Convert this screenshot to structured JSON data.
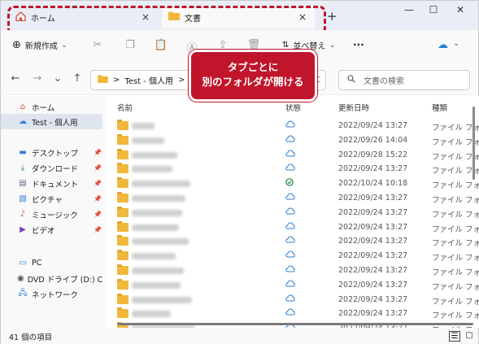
{
  "tabs": [
    {
      "label": "ホーム",
      "icon": "home-icon",
      "close": "×"
    },
    {
      "label": "文書",
      "icon": "folder-icon",
      "close": "×"
    }
  ],
  "new_tab": "+",
  "window_controls": {
    "minimize": "—",
    "maximize": "☐",
    "close": "✕"
  },
  "toolbar": {
    "new_label": "新規作成",
    "new_chevron": "⌄",
    "sort_label": "並べ替え",
    "sort_chevron": "⌄",
    "more": "···"
  },
  "address": {
    "back": "←",
    "forward": "→",
    "recent": "⌄",
    "up": "↑",
    "sep1": ">",
    "part1": "Test - 個人用",
    "sep2": ">",
    "part2": "文",
    "refresh": "C"
  },
  "search": {
    "placeholder": "文書の検索"
  },
  "callout": {
    "line1": "タブごとに",
    "line2": "別のフォルダが開ける"
  },
  "nav": {
    "home": "ホーム",
    "onedrive": "Test - 個人用",
    "desktop": "デスクトップ",
    "downloads": "ダウンロード",
    "documents": "ドキュメント",
    "pictures": "ピクチャ",
    "music": "ミュージック",
    "videos": "ビデオ",
    "pc": "PC",
    "dvd": "DVD ドライブ (D:) CCCC",
    "network": "ネットワーク"
  },
  "columns": {
    "name": "名前",
    "status": "状態",
    "modified": "更新日時",
    "type": "種類"
  },
  "files": [
    {
      "status": "cloud",
      "date": "2022/09/24 13:27",
      "type": "ファイル フォ"
    },
    {
      "status": "cloud",
      "date": "2022/09/26 14:04",
      "type": "ファイル フォ"
    },
    {
      "status": "cloud",
      "date": "2022/09/28 15:22",
      "type": "ファイル フォ"
    },
    {
      "status": "cloud",
      "date": "2022/09/24 13:27",
      "type": "ファイル フォ"
    },
    {
      "status": "synced",
      "date": "2022/10/24 10:18",
      "type": "ファイル フォ"
    },
    {
      "status": "cloud",
      "date": "2022/09/24 13:27",
      "type": "ファイル フォ"
    },
    {
      "status": "cloud",
      "date": "2022/09/24 13:27",
      "type": "ファイル フォ"
    },
    {
      "status": "cloud",
      "date": "2022/09/24 13:27",
      "type": "ファイル フォ"
    },
    {
      "status": "cloud",
      "date": "2022/09/24 13:27",
      "type": "ファイル フォ"
    },
    {
      "status": "cloud",
      "date": "2022/09/24 13:27",
      "type": "ファイル フォ"
    },
    {
      "status": "cloud",
      "date": "2022/09/24 13:27",
      "type": "ファイル フォ"
    },
    {
      "status": "cloud",
      "date": "2022/09/24 13:27",
      "type": "ファイル フォ"
    },
    {
      "status": "cloud",
      "date": "2022/09/24 13:27",
      "type": "ファイル フォ"
    },
    {
      "status": "cloud",
      "date": "2022/09/24 13:27",
      "type": "ファイル フォ"
    },
    {
      "status": "cloud",
      "date": "2022/09/24 13:27",
      "type": "ファイル フォ"
    }
  ],
  "status_bar": {
    "count": "41 個の項目"
  },
  "colors": {
    "accent": "#c0152a",
    "folder": "#f0b83c",
    "cloud": "#2d7fd3",
    "synced": "#1e8e3e"
  }
}
